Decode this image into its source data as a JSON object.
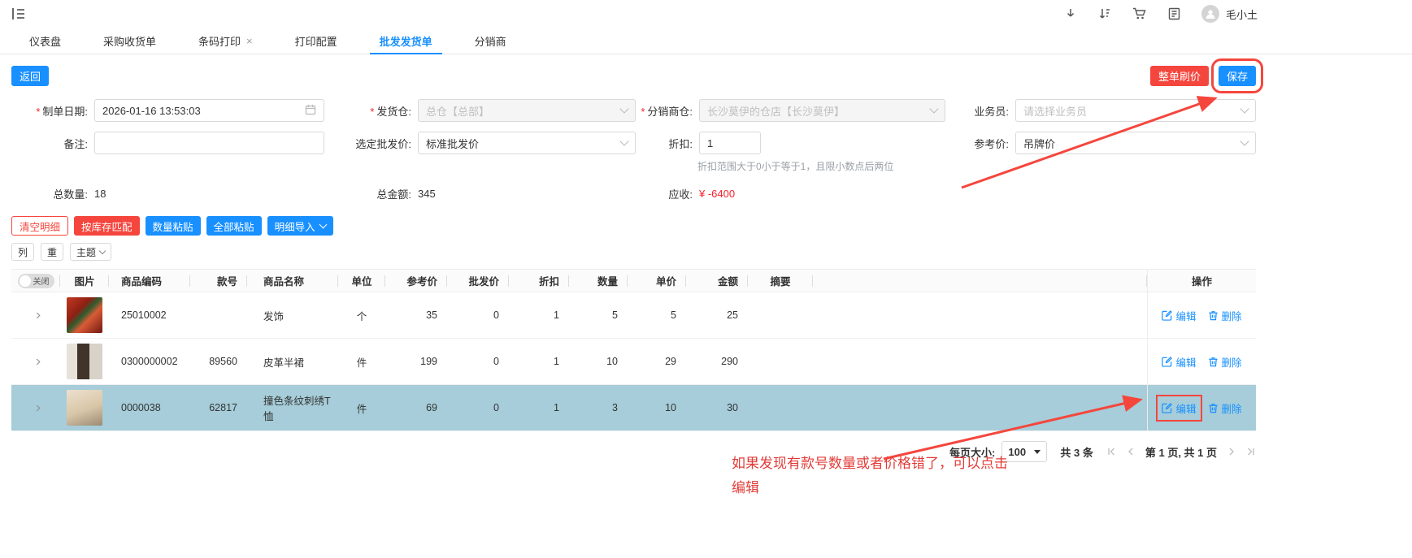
{
  "colors": {
    "accent": "#1890ff",
    "danger": "#f5463d",
    "selected_row": "#a6cdd9",
    "receivable": "#f5222d"
  },
  "topbar": {
    "user_name": "毛小土",
    "icons": [
      "menu-icon",
      "download-icon",
      "sort-icon",
      "cart-icon",
      "document-icon",
      "avatar"
    ]
  },
  "tabs": [
    {
      "label": "仪表盘"
    },
    {
      "label": "采购收货单"
    },
    {
      "label": "条码打印",
      "close": "×"
    },
    {
      "label": "打印配置"
    },
    {
      "label": "批发发货单",
      "active": true
    },
    {
      "label": "分销商"
    }
  ],
  "toolbar": {
    "back": "返回",
    "reprice": "整单刷价",
    "save": "保存"
  },
  "form": {
    "required_mark": "*",
    "order_date": {
      "label": "制单日期:",
      "value": "2026-01-16 13:53:03"
    },
    "ship_warehouse": {
      "label": "发货仓:",
      "value": "总仓【总部】"
    },
    "distributor_warehouse": {
      "label": "分销商仓:",
      "value": "长沙莫伊的仓店【长沙莫伊】"
    },
    "salesman": {
      "label": "业务员:",
      "placeholder": "请选择业务员"
    },
    "remark": {
      "label": "备注:",
      "value": ""
    },
    "price_type": {
      "label": "选定批发价:",
      "value": "标准批发价"
    },
    "discount": {
      "label": "折扣:",
      "value": "1",
      "hint": "折扣范围大于0小于等于1，且限小数点后两位"
    },
    "reference_price": {
      "label": "参考价:",
      "value": "吊牌价"
    }
  },
  "summary": {
    "total_qty_label": "总数量:",
    "total_qty": "18",
    "total_amount_label": "总金额:",
    "total_amount": "345",
    "receivable_label": "应收:",
    "receivable": "¥ -6400"
  },
  "actions": {
    "clear": "清空明细",
    "match_stock": "按库存匹配",
    "paste_qty": "数量粘贴",
    "paste_all": "全部粘贴",
    "import": "明细导入",
    "col": "列",
    "weight": "重",
    "theme": "主题"
  },
  "table": {
    "toggle_label": "关闭",
    "headers": [
      "图片",
      "商品编码",
      "款号",
      "商品名称",
      "单位",
      "参考价",
      "批发价",
      "折扣",
      "数量",
      "单价",
      "金额",
      "摘要",
      "操作"
    ],
    "edit_label": "编辑",
    "delete_label": "删除",
    "rows": [
      {
        "code": "25010002",
        "style_no": "",
        "name": "发饰",
        "unit": "个",
        "ref_price": "35",
        "wholesale_price": "0",
        "discount": "1",
        "qty": "5",
        "unit_price": "5",
        "amount": "25",
        "summary": ""
      },
      {
        "code": "0300000002",
        "style_no": "89560",
        "name": "皮革半裙",
        "unit": "件",
        "ref_price": "199",
        "wholesale_price": "0",
        "discount": "1",
        "qty": "10",
        "unit_price": "29",
        "amount": "290",
        "summary": ""
      },
      {
        "code": "0000038",
        "style_no": "62817",
        "name": "撞色条纹刺绣T恤",
        "unit": "件",
        "ref_price": "69",
        "wholesale_price": "0",
        "discount": "1",
        "qty": "3",
        "unit_price": "10",
        "amount": "30",
        "summary": ""
      }
    ]
  },
  "pagination": {
    "page_size_label": "每页大小:",
    "page_size": "100",
    "total": "共 3 条",
    "page_info": "第 1 页, 共 1 页"
  },
  "annotation": {
    "line1": "如果发现有款号数量或者价格错了，可以点击",
    "line2": "编辑"
  }
}
